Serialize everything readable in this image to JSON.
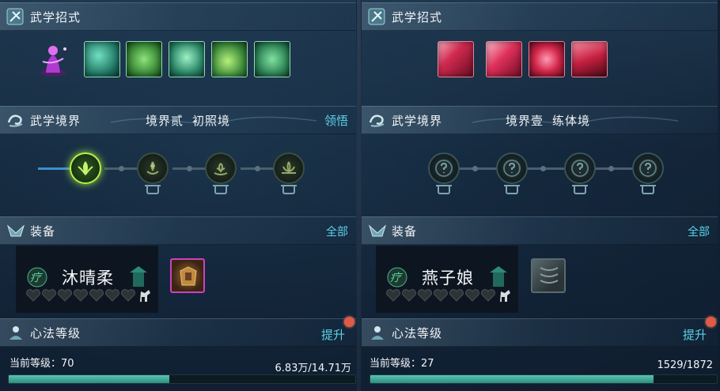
{
  "left": {
    "moves_header": "武学招式",
    "realm_header": "武学境界",
    "realm_level": "境界贰",
    "realm_name": "初照境",
    "realm_action": "领悟",
    "equip_header": "装备",
    "equip_action": "全部",
    "companion_badge": "疗",
    "companion_name": "沐晴柔",
    "heart_count": 7,
    "hearts_filled": 0,
    "xinfa_header": "心法等级",
    "xinfa_action": "提升",
    "level_text": "当前等级：70",
    "exp_text": "6.83万/14.71万",
    "progress": 0.464,
    "icons": {
      "moves": "martial-moves-icon",
      "realm": "realm-swirl-icon",
      "equip": "equipment-icon",
      "xinfa": "heart-method-icon"
    },
    "skill_colors": [
      "#3bbf8f",
      "#57c14f",
      "#40b07a",
      "#7fd36a",
      "#3aa97a"
    ],
    "realm_nodes": [
      "active",
      "dim",
      "dim",
      "dim"
    ]
  },
  "right": {
    "moves_header": "武学招式",
    "realm_header": "武学境界",
    "realm_level": "境界壹",
    "realm_name": "练体境",
    "equip_header": "装备",
    "equip_action": "全部",
    "companion_badge": "疗",
    "companion_name": "燕子娘",
    "heart_count": 7,
    "hearts_filled": 0,
    "xinfa_header": "心法等级",
    "xinfa_action": "提升",
    "level_text": "当前等级：27",
    "exp_text": "1529/1872",
    "progress": 0.817,
    "skill_colors": [
      "#d9304f",
      "#e0385a",
      "#d4284a",
      "#c42040"
    ],
    "realm_nodes": [
      "lock",
      "lock",
      "lock",
      "lock"
    ]
  }
}
